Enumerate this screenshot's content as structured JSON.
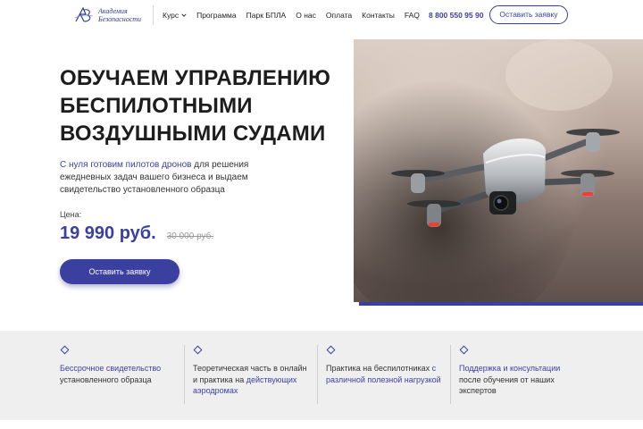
{
  "header": {
    "logo_text_line1": "Академия",
    "logo_text_line2": "Безопасности",
    "nav": [
      {
        "label": "Курс"
      },
      {
        "label": "Программа"
      },
      {
        "label": "Парк БПЛА"
      },
      {
        "label": "О нас"
      },
      {
        "label": "Оплата"
      },
      {
        "label": "Контакты"
      },
      {
        "label": "FAQ"
      }
    ],
    "phone": "8 800 550 95 90",
    "cta_label": "Оставить заявку"
  },
  "hero": {
    "title_line1": "ОБУЧАЕМ УПРАВЛЕНИЮ",
    "title_line2": "БЕСПИЛОТНЫМИ",
    "title_line3": "ВОЗДУШНЫМИ СУДАМИ",
    "desc_accent": "С нуля готовим пилотов дронов",
    "desc_rest": " для решения ежедневных задач вашего бизнеса и выдаем свидетельство установленного образца",
    "price_label": "Цена:",
    "price": "19 990 руб.",
    "old_price": "30 000 руб.",
    "cta_label": "Оставить заявку",
    "image": "drone-photo"
  },
  "features": [
    {
      "accent": "Бессрочное свидетельство",
      "text": " установленного образца"
    },
    {
      "text_before": "Теоретическая часть в онлайн и практика на ",
      "accent": "действующих аэродромах"
    },
    {
      "text_before": "Практика на беспилотниках ",
      "accent": "с различной полезной нагрузкой"
    },
    {
      "accent": "Поддержка и консультации",
      "text": " после обучения от наших экспертов"
    }
  ],
  "colors": {
    "accent": "#3b3fa0",
    "strip_background": "#efefef",
    "text": "#222222"
  }
}
